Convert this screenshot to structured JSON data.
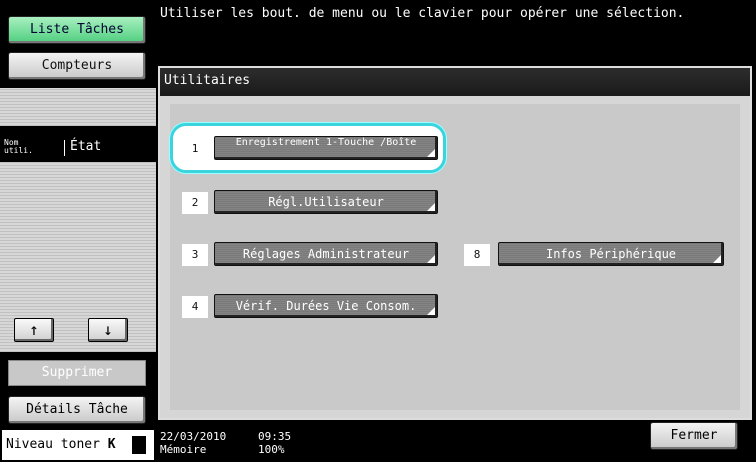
{
  "left_panel": {
    "job_list_label": "Liste Tâches",
    "counters_label": "Compteurs",
    "header_user": "Nom utili.",
    "header_status": "État",
    "delete_label": "Supprimer",
    "job_details_label": "Détails Tâche",
    "toner_label": "Niveau toner",
    "toner_color": "K"
  },
  "message": "Utiliser les bout. de menu ou le clavier pour opérer une sélection.",
  "main": {
    "title": "Utilitaires",
    "items": [
      {
        "num": "1",
        "label": "Enregistrement 1-Touche /Boîte"
      },
      {
        "num": "2",
        "label": "Régl.Utilisateur"
      },
      {
        "num": "3",
        "label": "Réglages Administrateur"
      },
      {
        "num": "4",
        "label": "Vérif. Durées Vie Consom."
      },
      {
        "num": "8",
        "label": "Infos Périphérique"
      }
    ]
  },
  "footer": {
    "date": "22/03/2010",
    "time": "09:35",
    "memory_label": "Mémoire",
    "memory_value": "100%",
    "close_label": "Fermer"
  },
  "colors": {
    "selection_ring": "#3bd3de",
    "active_tab": "#4fce7e"
  }
}
